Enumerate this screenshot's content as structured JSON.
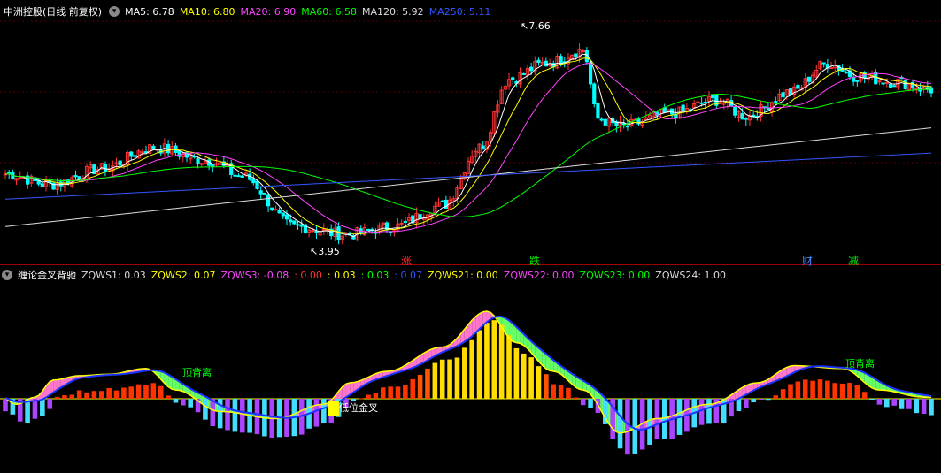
{
  "top_header": {
    "title": "中洲控股(日线 前复权)",
    "dropdown_icon": "chevron-down-icon",
    "items": [
      {
        "text": "MA5: 6.78",
        "color": "#ffffff"
      },
      {
        "text": "MA10: 6.80",
        "color": "#ffff00"
      },
      {
        "text": "MA20: 6.90",
        "color": "#ff44ff"
      },
      {
        "text": "MA60: 6.58",
        "color": "#00ff00"
      },
      {
        "text": "MA120: 5.92",
        "color": "#dddddd"
      },
      {
        "text": "MA250: 5.11",
        "color": "#3355ff"
      }
    ]
  },
  "bottom_header": {
    "title": "缠论金叉背驰",
    "dropdown_icon": "chevron-down-icon",
    "items": [
      {
        "text": "ZQWS1: 0.03",
        "color": "#dddddd"
      },
      {
        "text": "ZQWS2: 0.07",
        "color": "#ffff00"
      },
      {
        "text": "ZQWS3: -0.08",
        "color": "#ff44ff"
      },
      {
        "text": ": 0.00",
        "color": "#ff3333"
      },
      {
        "text": ": 0.03",
        "color": "#ffff00"
      },
      {
        "text": ": 0.03",
        "color": "#00ff00"
      },
      {
        "text": ": 0.07",
        "color": "#3355ff"
      },
      {
        "text": "ZQWS21: 0.00",
        "color": "#ffff00"
      },
      {
        "text": "ZQWS22: 0.00",
        "color": "#ff44ff"
      },
      {
        "text": "ZQWS23: 0.00",
        "color": "#00ff00"
      },
      {
        "text": "ZQWS24: 1.00",
        "color": "#dddddd"
      }
    ]
  },
  "price_annotations": {
    "high": "7.66",
    "low": "3.95"
  },
  "event_markers": [
    {
      "text": "涨",
      "color": "#ff2222"
    },
    {
      "text": "跌",
      "color": "#00ee00"
    },
    {
      "text": "财",
      "color": "#4488ff"
    },
    {
      "text": "减",
      "color": "#00ee00"
    }
  ],
  "indicator_labels": {
    "top_div_1": "顶背离",
    "top_div_2": "顶背离",
    "low_golden": "低位金叉"
  },
  "colors": {
    "up": "#ff3333",
    "down": "#00ffff",
    "ma5": "#ffffff",
    "ma10": "#ffff00",
    "ma20": "#ff44ff",
    "ma60": "#00ff00",
    "ma120": "#dddddd",
    "ma250": "#3355ff"
  },
  "chart_data": [
    {
      "type": "candlestick",
      "title": "中洲控股(日线 前复权)",
      "ylim": [
        3.6,
        8.1
      ],
      "annotations": [
        {
          "label": "7.66",
          "kind": "max"
        },
        {
          "label": "3.95",
          "kind": "min"
        }
      ],
      "series": [
        {
          "name": "MA5",
          "value": 6.78
        },
        {
          "name": "MA10",
          "value": 6.8
        },
        {
          "name": "MA20",
          "value": 6.9
        },
        {
          "name": "MA60",
          "value": 6.58
        },
        {
          "name": "MA120",
          "value": 5.92
        },
        {
          "name": "MA250",
          "value": 5.11
        }
      ],
      "path_keys": [
        [
          0,
          5.2
        ],
        [
          12,
          5.0
        ],
        [
          26,
          5.3
        ],
        [
          40,
          5.7
        ],
        [
          55,
          5.45
        ],
        [
          64,
          5.15
        ],
        [
          78,
          4.2
        ],
        [
          92,
          4.05
        ],
        [
          105,
          4.2
        ],
        [
          118,
          4.6
        ],
        [
          128,
          5.7
        ],
        [
          136,
          7.0
        ],
        [
          146,
          7.3
        ],
        [
          156,
          7.55
        ],
        [
          160,
          6.25
        ],
        [
          166,
          6.1
        ],
        [
          180,
          6.35
        ],
        [
          192,
          6.6
        ],
        [
          200,
          6.3
        ],
        [
          212,
          6.75
        ],
        [
          222,
          7.3
        ],
        [
          230,
          7.05
        ],
        [
          240,
          6.95
        ],
        [
          250,
          6.8
        ]
      ]
    },
    {
      "type": "bar",
      "title": "缠论金叉背驰",
      "ylim": [
        -0.45,
        0.55
      ],
      "series": [
        {
          "name": "ZQWS1",
          "value": 0.03
        },
        {
          "name": "ZQWS2",
          "value": 0.07
        },
        {
          "name": "ZQWS3",
          "value": -0.08
        },
        {
          "name": "ZQWS21",
          "value": 0.0
        },
        {
          "name": "ZQWS22",
          "value": 0.0
        },
        {
          "name": "ZQWS23",
          "value": 0.0
        },
        {
          "name": "ZQWS24",
          "value": 1.0
        }
      ],
      "hist_keys": [
        [
          0,
          -0.08
        ],
        [
          5,
          -0.15
        ],
        [
          10,
          -0.1
        ],
        [
          15,
          0.02
        ],
        [
          22,
          0.05
        ],
        [
          30,
          0.06
        ],
        [
          40,
          0.1
        ],
        [
          48,
          -0.05
        ],
        [
          60,
          -0.2
        ],
        [
          75,
          -0.25
        ],
        [
          88,
          -0.15
        ],
        [
          95,
          0.0
        ],
        [
          105,
          0.08
        ],
        [
          120,
          0.25
        ],
        [
          132,
          0.5
        ],
        [
          140,
          0.28
        ],
        [
          150,
          0.08
        ],
        [
          158,
          -0.05
        ],
        [
          168,
          -0.35
        ],
        [
          178,
          -0.25
        ],
        [
          192,
          -0.15
        ],
        [
          205,
          0.0
        ],
        [
          215,
          0.12
        ],
        [
          228,
          0.1
        ],
        [
          238,
          -0.05
        ],
        [
          250,
          -0.1
        ]
      ]
    }
  ]
}
